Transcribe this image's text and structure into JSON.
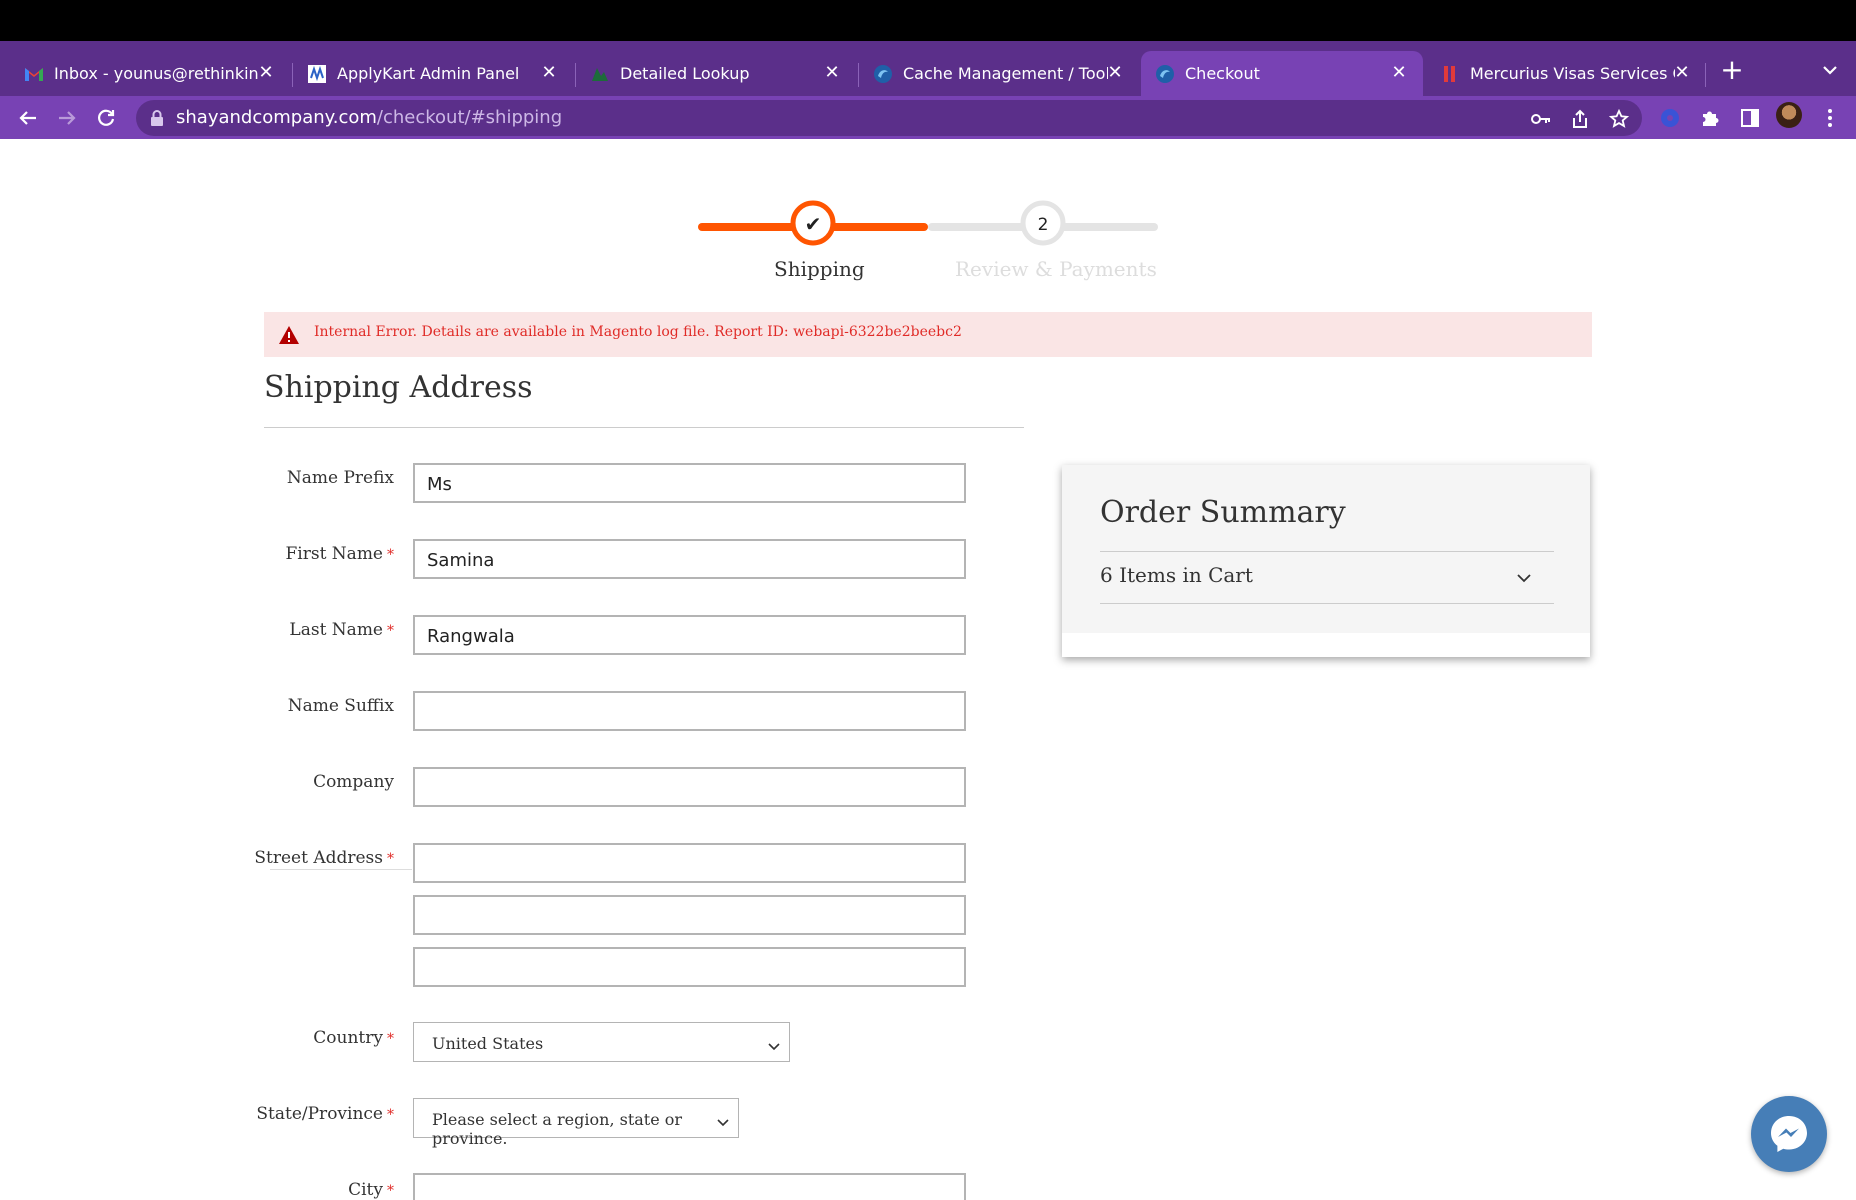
{
  "browser": {
    "tabs": [
      {
        "title": "Inbox - younus@rethinkingweb.com",
        "icon": "gmail-icon"
      },
      {
        "title": "ApplyKart Admin Panel",
        "icon": "applykart-icon"
      },
      {
        "title": "Detailed Lookup",
        "icon": "lookup-icon"
      },
      {
        "title": "Cache Management / Tools / Sys",
        "icon": "magento-icon"
      },
      {
        "title": "Checkout",
        "icon": "magento-icon",
        "active": true
      },
      {
        "title": "Mercurius Visas Services Global",
        "icon": "mercurius-icon"
      }
    ],
    "close_glyph": "✕",
    "new_tab_glyph": "+",
    "url_host": "shayandcompany.com",
    "url_path": "/checkout/#shipping"
  },
  "checkout": {
    "steps": [
      {
        "number": "✔",
        "label": "Shipping",
        "state": "complete"
      },
      {
        "number": "2",
        "label": "Review & Payments",
        "state": "upcoming"
      }
    ],
    "accent_color": "#ff5501",
    "error_message": "Internal Error. Details are available in Magento log file. Report ID: webapi-6322be2beebc2",
    "section_title": "Shipping Address",
    "required_marker": "*",
    "fields": {
      "name_prefix": {
        "label": "Name Prefix",
        "value": "Ms"
      },
      "first_name": {
        "label": "First Name",
        "value": "Samina"
      },
      "last_name": {
        "label": "Last Name",
        "value": "Rangwala"
      },
      "name_suffix": {
        "label": "Name Suffix",
        "value": ""
      },
      "company": {
        "label": "Company",
        "value": ""
      },
      "street_address": {
        "label": "Street Address",
        "lines": [
          "",
          "",
          ""
        ]
      },
      "country": {
        "label": "Country",
        "value": "United States"
      },
      "state": {
        "label": "State/Province",
        "value": "Please select a region, state or province."
      },
      "city": {
        "label": "City",
        "value": ""
      }
    }
  },
  "order_summary": {
    "title": "Order Summary",
    "items_in_cart": "6 Items in Cart"
  }
}
